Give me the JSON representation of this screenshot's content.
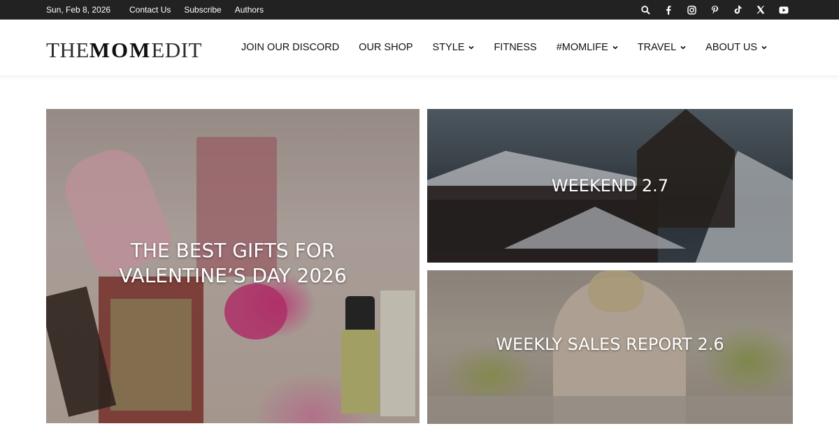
{
  "topbar": {
    "date": "Sun, Feb 8, 2026",
    "links": [
      "Contact Us",
      "Subscribe",
      "Authors"
    ],
    "icons": [
      "search-icon",
      "facebook-icon",
      "instagram-icon",
      "pinterest-icon",
      "tiktok-icon",
      "x-icon",
      "youtube-icon"
    ],
    "background": "#222222"
  },
  "header": {
    "logo_light": "THE",
    "logo_bold": "MOM",
    "logo_light2": "EDIT",
    "nav": [
      {
        "label": "JOIN OUR DISCORD",
        "dropdown": false
      },
      {
        "label": "OUR SHOP",
        "dropdown": false
      },
      {
        "label": "STYLE",
        "dropdown": true
      },
      {
        "label": "FITNESS",
        "dropdown": false
      },
      {
        "label": "#MOMLIFE",
        "dropdown": true
      },
      {
        "label": "TRAVEL",
        "dropdown": true
      },
      {
        "label": "ABOUT US",
        "dropdown": true
      }
    ]
  },
  "featured": {
    "main": {
      "line1": "THE BEST GIFTS FOR",
      "line2": "VALENTINE’S DAY 2026"
    },
    "secondary": [
      {
        "title": "WEEKEND 2.7"
      },
      {
        "title": "WEEKLY SALES REPORT 2.6"
      }
    ]
  }
}
